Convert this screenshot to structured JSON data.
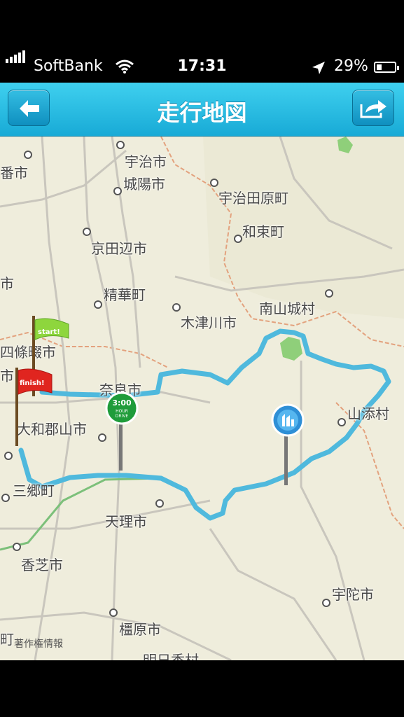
{
  "status_bar": {
    "carrier": "SoftBank",
    "time": "17:31",
    "battery": "29%",
    "battery_level": 0.29
  },
  "nav": {
    "title": "走行地図",
    "back_icon": "back-arrow-icon",
    "share_icon": "share-arrow-icon"
  },
  "map": {
    "places": [
      "宇治市",
      "城陽市",
      "宇治田原町",
      "和束町",
      "京田辺市",
      "精華町",
      "南山城村",
      "木津川市",
      "奈良市",
      "山添村",
      "大和郡山市",
      "天理市",
      "香芝市",
      "宇陀市",
      "橿原市",
      "明日香村",
      "四條畷市",
      "三郷町",
      "番市",
      "市",
      "市",
      "町"
    ],
    "markers": {
      "start": "start!",
      "finish": "finish!",
      "drive_time": "3:00",
      "drive_unit_1": "HOUR",
      "drive_unit_2": "DRIVE"
    },
    "credit": "著作権情報",
    "route_color": "#4fb9dd"
  }
}
